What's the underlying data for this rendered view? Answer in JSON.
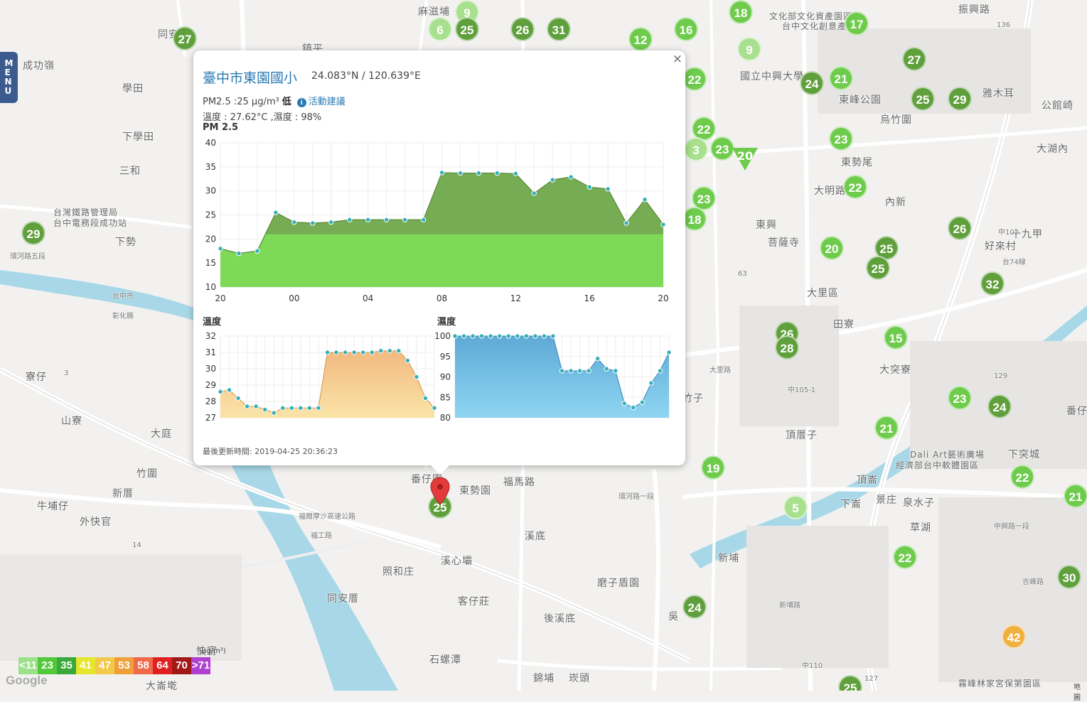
{
  "menu": {
    "label": "MENU"
  },
  "popup": {
    "close_label": "×",
    "station_name": "臺中市東園國小",
    "coords": "24.083°N / 120.639°E",
    "pm_text": "PM2.5 :25 μg/m³",
    "pm_level": "低",
    "advice_icon": "info-icon",
    "advice_label": "活動建議",
    "temp_humidity": "溫度 : 27.62°C ,濕度 : 98%",
    "updated": "最後更新時間: 2019-04-25 20:36:23"
  },
  "chart_data": [
    {
      "type": "area",
      "title": "PM 2.5",
      "x_ticks": [
        "20",
        "00",
        "04",
        "08",
        "12",
        "16",
        "20"
      ],
      "ylim": [
        10,
        40
      ],
      "y_ticks": [
        10,
        15,
        20,
        25,
        30,
        35,
        40
      ],
      "series": [
        {
          "values": [
            18,
            17,
            17.5,
            25.5,
            23.5,
            23.3,
            23.5,
            24,
            24,
            24,
            24,
            24,
            33.8,
            33.7,
            33.7,
            33.7,
            33.6,
            29.5,
            32.3,
            32.9,
            30.8,
            30.4,
            23.3,
            28.2,
            23
          ]
        }
      ],
      "fill_colors": [
        "#7ed957",
        "#6fa84a"
      ]
    },
    {
      "type": "area",
      "title": "溫度",
      "ylim": [
        27,
        32
      ],
      "y_ticks": [
        27,
        28,
        29,
        30,
        31,
        32
      ],
      "series": [
        {
          "values": [
            28.6,
            28.7,
            28.2,
            27.7,
            27.7,
            27.5,
            27.3,
            27.6,
            27.6,
            27.6,
            27.6,
            27.6,
            31,
            31,
            31,
            31,
            31,
            31,
            31.1,
            31.1,
            31.1,
            30.5,
            29.5,
            28.2,
            27.6
          ]
        }
      ],
      "fill_colors": [
        "#fbe4a8",
        "#f1b980"
      ]
    },
    {
      "type": "area",
      "title": "濕度",
      "ylim": [
        80,
        100
      ],
      "y_ticks": [
        80,
        85,
        90,
        95,
        100
      ],
      "series": [
        {
          "values": [
            100,
            100,
            100,
            100,
            100,
            100,
            100,
            100,
            100,
            100,
            100,
            100,
            91.5,
            91.5,
            91.5,
            91.5,
            94.5,
            92,
            91.5,
            83.5,
            82.5,
            83.8,
            88.5,
            91.5,
            96
          ]
        }
      ],
      "fill_colors": [
        "#8fd6f2",
        "#5ea9d6"
      ]
    }
  ],
  "legend": {
    "unit": "(μg/m³)",
    "items": [
      {
        "label": "<11",
        "color": "#9ce08a"
      },
      {
        "label": "23",
        "color": "#52c83a"
      },
      {
        "label": "35",
        "color": "#3aa83a"
      },
      {
        "label": "41",
        "color": "#e6e62e"
      },
      {
        "label": "47",
        "color": "#f2c94a"
      },
      {
        "label": "53",
        "color": "#f0a03a"
      },
      {
        "label": "58",
        "color": "#f06a4a"
      },
      {
        "label": "64",
        "color": "#e02020"
      },
      {
        "label": "70",
        "color": "#a01818"
      },
      {
        "label": ">71",
        "color": "#b040d0"
      }
    ]
  },
  "map": {
    "place_labels": [
      "麻滋埔",
      "同安",
      "鎮平",
      "學田",
      "成功嶺",
      "下學田",
      "三和",
      "下勢",
      "台灣鐵路管理局",
      "台中電務段成功站",
      "寮仔",
      "山寮",
      "大庭",
      "竹圍",
      "新厝",
      "牛埔仔",
      "外快官",
      "大崙墘",
      "番仔園",
      "東勢園",
      "溪底",
      "溪心壩",
      "照和庄",
      "同安厝",
      "客仔莊",
      "後溪底",
      "磨子盾園",
      "石螺潭",
      "錦埔",
      "崁頭",
      "新埔",
      "吳",
      "下崙",
      "頂崙",
      "景庄",
      "泉水子",
      "草湖",
      "頂厝子",
      "大突寮",
      "田寮",
      "大里區",
      "東興",
      "菩薩寺",
      "內新",
      "大湖內",
      "好來村",
      "十九甲",
      "公館崎",
      "雅木耳",
      "烏竹圍",
      "東勢尾",
      "國立中興大學",
      "東峰公園",
      "台中文化創意產業",
      "文化部文化資產園區",
      "振興路",
      "下突城",
      "番仔",
      "經濟部台中軟體園區",
      "Dali Art藝術廣場",
      "霧峰林家宮保第園區",
      "快官",
      "竹子",
      "福馬路",
      "大明路"
    ],
    "road_labels": [
      "福爾摩沙高速公路",
      "環河路五段",
      "台中市",
      "彰化縣",
      "台74線",
      "中105-1",
      "中110",
      "中102",
      "129",
      "127",
      "136",
      "63",
      "14",
      "3",
      "福工路",
      "吉峰路",
      "中興路一段",
      "新埔路",
      "環河路一段",
      "大里路"
    ],
    "markers": [
      {
        "value": "27",
        "level": "2"
      },
      {
        "value": "9",
        "level": "1"
      },
      {
        "value": "6",
        "level": "1"
      },
      {
        "value": "25",
        "level": "2"
      },
      {
        "value": "26",
        "level": "2"
      },
      {
        "value": "31",
        "level": "2"
      },
      {
        "value": "12",
        "level": "0"
      },
      {
        "value": "16",
        "level": "0"
      },
      {
        "value": "18",
        "level": "0"
      },
      {
        "value": "17",
        "level": "0"
      },
      {
        "value": "9",
        "level": "1"
      },
      {
        "value": "27",
        "level": "2"
      },
      {
        "value": "22",
        "level": "0"
      },
      {
        "value": "24",
        "level": "2"
      },
      {
        "value": "21",
        "level": "0"
      },
      {
        "value": "25",
        "level": "2"
      },
      {
        "value": "29",
        "level": "2"
      },
      {
        "value": "22",
        "level": "0"
      },
      {
        "value": "3",
        "level": "1"
      },
      {
        "value": "23",
        "level": "0"
      },
      {
        "value": "23",
        "level": "0"
      },
      {
        "value": "22",
        "level": "0"
      },
      {
        "value": "23",
        "level": "0"
      },
      {
        "value": "18",
        "level": "0"
      },
      {
        "value": "26",
        "level": "2"
      },
      {
        "value": "20",
        "level": "0"
      },
      {
        "value": "25",
        "level": "2"
      },
      {
        "value": "25",
        "level": "2"
      },
      {
        "value": "32",
        "level": "2"
      },
      {
        "value": "29",
        "level": "2"
      },
      {
        "value": "26",
        "level": "2"
      },
      {
        "value": "28",
        "level": "2"
      },
      {
        "value": "15",
        "level": "0"
      },
      {
        "value": "23",
        "level": "0"
      },
      {
        "value": "24",
        "level": "2"
      },
      {
        "value": "21",
        "level": "0"
      },
      {
        "value": "19",
        "level": "0"
      },
      {
        "value": "5",
        "level": "1"
      },
      {
        "value": "22",
        "level": "0"
      },
      {
        "value": "21",
        "level": "0"
      },
      {
        "value": "22",
        "level": "0"
      },
      {
        "value": "30",
        "level": "2"
      },
      {
        "value": "24",
        "level": "2"
      },
      {
        "value": "42",
        "level": "3"
      },
      {
        "value": "25",
        "level": "2"
      },
      {
        "value": "25",
        "level": "2"
      }
    ],
    "triangle_value": "20",
    "level_colors": [
      "#6ecb4c",
      "#a9e08f",
      "#5f9f3c",
      "#f0b040"
    ],
    "pin_color": "#e33b3b",
    "attribution": "Google",
    "map_data": "地圖"
  }
}
